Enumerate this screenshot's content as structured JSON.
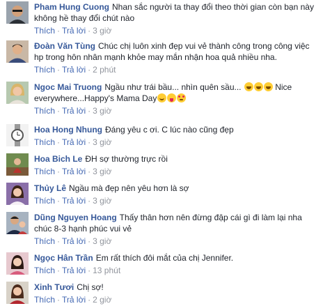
{
  "actions": {
    "like": "Thích",
    "reply": "Trả lời",
    "separator": "·"
  },
  "comments": [
    {
      "author": "Pham Hung Cuong",
      "text": "Nhan sắc người ta thay đổi theo thời gian còn bạn này không hề thay đổi chút nào",
      "time": "3 giờ",
      "avatar": "man-with-sunglasses"
    },
    {
      "author": "Đoàn Văn Tùng",
      "text": "Chúc chị luôn xinh đẹp vui vẻ thành công trong công việc hp trong hôn nhân mạnh khỏe may mắn nhận hoa quả nhiều nha.",
      "time": "2 phút",
      "avatar": "man-portrait"
    },
    {
      "author": "Ngoc Mai Truong",
      "text": "Ngầu như trái bầu... nhìn quên sầu...",
      "text2": "Nice everywhere...Happy's Mama Day",
      "time": "3 giờ",
      "avatar": "woman-blonde"
    },
    {
      "author": "Hoa Hong Nhung",
      "text": "Đáng yêu c ơi. C lúc nào cũng đẹp",
      "time": "3 giờ",
      "avatar": "wristwatch"
    },
    {
      "author": "Hoa Bich Le",
      "text": "ĐH sợ thường trực rồi",
      "time": "3 giờ",
      "avatar": "woman-outdoor"
    },
    {
      "author": "Thủy Lê",
      "text": "Ngầu mà đẹp nên yêu hơn là sợ",
      "time": "3 giờ",
      "avatar": "woman-purple"
    },
    {
      "author": "Dũng Nguyen Hoang",
      "text": "Thấy thân hơn nên đừng đập cái gì đi làm lại nha chúc 8-3 hạnh phúc vui vẻ",
      "time": "3 giờ",
      "avatar": "man-with-child"
    },
    {
      "author": "Ngọc Hân Trần",
      "text": "Em rất thích đôi mắt của chị Jennifer.",
      "time": "13 phút",
      "avatar": "woman-pink"
    },
    {
      "author": "Xinh Tươi",
      "text": "Chị sợ!",
      "time": "2 giờ",
      "avatar": "woman-red"
    }
  ]
}
